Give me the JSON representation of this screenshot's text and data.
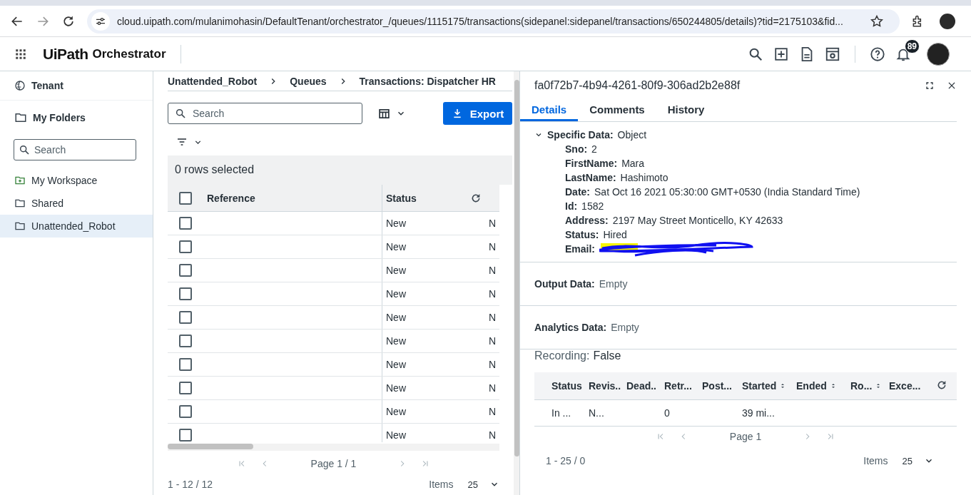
{
  "browser": {
    "url": "cloud.uipath.com/mulanimohasin/DefaultTenant/orchestrator_/queues/1115175/transactions(sidepanel:sidepanel/transactions/650244805/details)?tid=2175103&fid..."
  },
  "header": {
    "logo": "UiPath",
    "product": "Orchestrator",
    "notifications": "89"
  },
  "sidebar": {
    "tenant": "Tenant",
    "folders_title": "My Folders",
    "search": {
      "placeholder": "Search"
    },
    "items": [
      {
        "label": "My Workspace",
        "kind": "workspace",
        "selected": false
      },
      {
        "label": "Shared",
        "kind": "folder",
        "selected": false
      },
      {
        "label": "Unattended_Robot",
        "kind": "folder",
        "selected": true
      }
    ]
  },
  "breadcrumb": [
    "Unattended_Robot",
    "Queues",
    "Transactions: Dispatcher HR"
  ],
  "toolbar": {
    "search": {
      "placeholder": "Search"
    },
    "export": "Export"
  },
  "table": {
    "selection": "0 rows selected",
    "all_checked": false,
    "columns": [
      "Reference",
      "Status"
    ],
    "rows": [
      {
        "checked": false,
        "status": "New",
        "column_3": "N"
      },
      {
        "checked": false,
        "status": "New",
        "column_3": "N"
      },
      {
        "checked": false,
        "status": "New",
        "column_3": "N"
      },
      {
        "checked": false,
        "status": "New",
        "column_3": "N"
      },
      {
        "checked": false,
        "status": "New",
        "column_3": "N"
      },
      {
        "checked": false,
        "status": "New",
        "column_3": "N"
      },
      {
        "checked": false,
        "status": "New",
        "column_3": "N"
      },
      {
        "checked": false,
        "status": "New",
        "column_3": "N"
      },
      {
        "checked": false,
        "status": "New",
        "column_3": "N"
      },
      {
        "checked": false,
        "status": "New",
        "column_3": "N"
      }
    ],
    "pagination": {
      "page": "Page 1 / 1",
      "range": "1 - 12 / 12",
      "items_label": "Items",
      "items": "25"
    }
  },
  "details": {
    "title": "fa0f72b7-4b94-4261-80f9-306ad2b2e88f",
    "tabs": [
      {
        "label": "Details",
        "selected": true
      },
      {
        "label": "Comments",
        "selected": false
      },
      {
        "label": "History",
        "selected": false
      }
    ],
    "specific": {
      "label": "Specific Data:",
      "value": "Object",
      "expanded": true,
      "fields": [
        {
          "key": "Sno:",
          "value": "2"
        },
        {
          "key": "FirstName:",
          "value": "Mara"
        },
        {
          "key": "LastName:",
          "value": "Hashimoto"
        },
        {
          "key": "Date:",
          "value": "Sat Oct 16 2021 05:30:00 GMT+0530 (India Standard Time)"
        },
        {
          "key": "Id:",
          "value": "1582"
        },
        {
          "key": "Address:",
          "value": "2197 May Street Monticello, KY 42633"
        },
        {
          "key": "Status:",
          "value": "Hired"
        },
        {
          "key": "Email:",
          "kind": "redacted"
        }
      ]
    },
    "output": {
      "label": "Output Data:",
      "value": "Empty"
    },
    "analytics": {
      "label": "Analytics Data:",
      "value": "Empty"
    },
    "recording": {
      "label": "Recording:",
      "value": "False"
    },
    "history": {
      "columns": [
        {
          "label": "Status",
          "sortable": false
        },
        {
          "label": "Revis..",
          "sortable": false
        },
        {
          "label": "Dead..",
          "sortable": false
        },
        {
          "label": "Retr...",
          "sortable": false
        },
        {
          "label": "Post...",
          "sortable": false
        },
        {
          "label": "Started",
          "sortable": true
        },
        {
          "label": "Ended",
          "sortable": true
        },
        {
          "label": "Ro...",
          "sortable": true
        },
        {
          "label": "Exce...",
          "sortable": false
        }
      ],
      "rows": [
        {
          "column_1": "In ...",
          "column_2": "N...",
          "column_4": "0",
          "column_6": "39 mi..."
        }
      ],
      "pagination": {
        "page": "Page 1",
        "range": "1 - 25 / 0",
        "items_label": "Items",
        "items": "25"
      }
    }
  }
}
